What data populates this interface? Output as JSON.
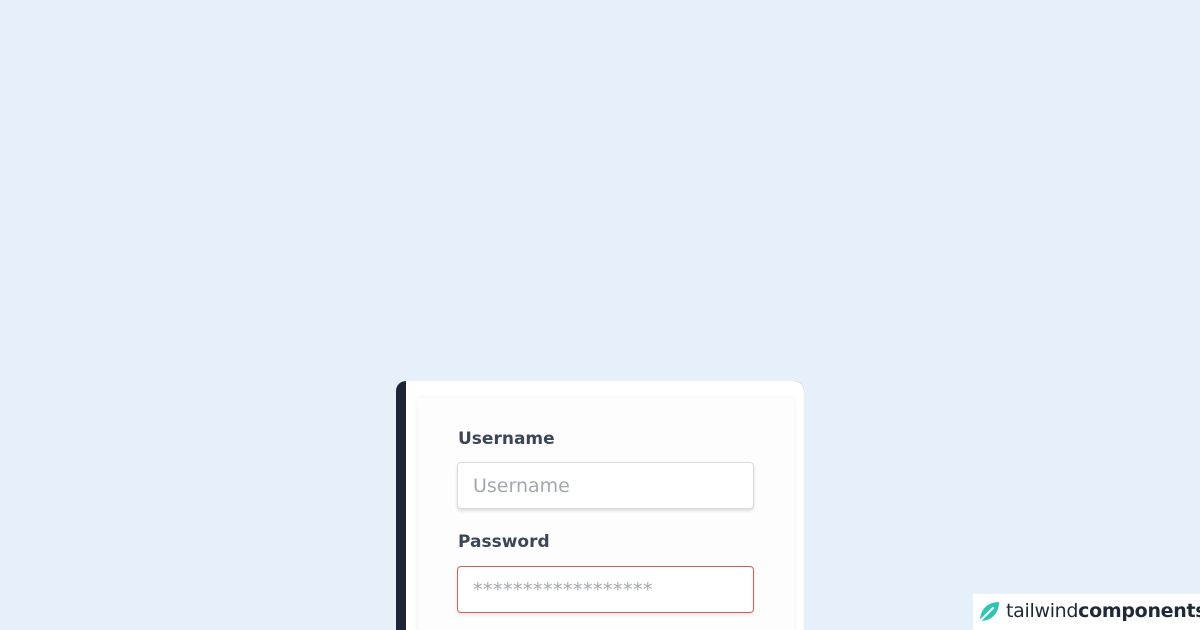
{
  "form": {
    "username_label": "Username",
    "username_placeholder": "Username",
    "password_label": "Password",
    "password_placeholder": "******************"
  },
  "brand": {
    "light_text": "tailwind",
    "bold_text": "components",
    "icon": "leaf-icon"
  },
  "colors": {
    "background": "#e6f0fb",
    "card_accent": "#1e2536",
    "error_border": "#e05757",
    "brand_icon": "#2ec4b6"
  }
}
